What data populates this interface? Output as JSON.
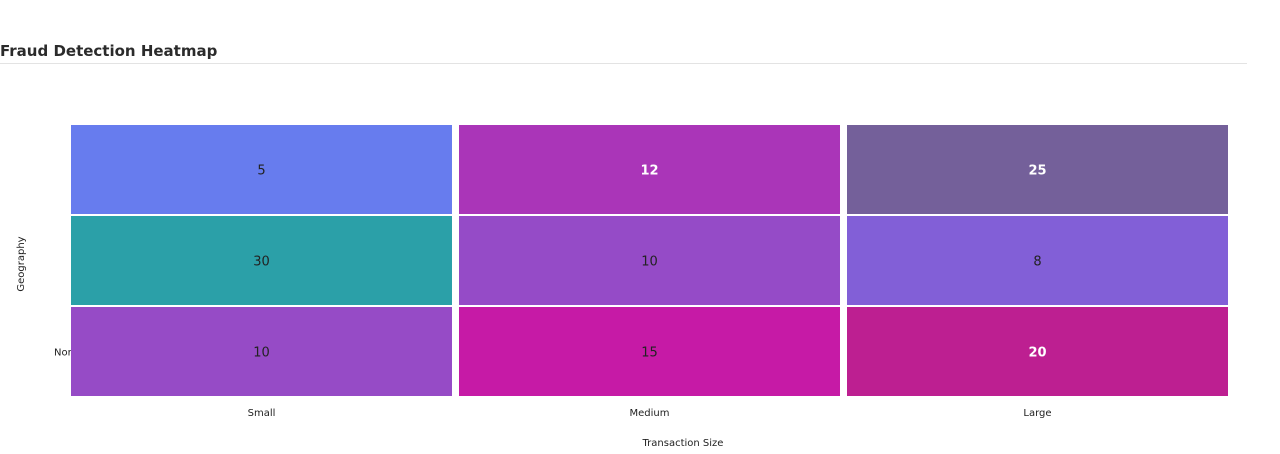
{
  "chart_data": {
    "type": "heatmap",
    "title": "Fraud Detection Heatmap",
    "xlabel": "Transaction Size",
    "ylabel": "Geography",
    "x_categories": [
      "Small",
      "Medium",
      "Large"
    ],
    "y_categories": [
      "",
      "",
      "Nor"
    ],
    "values": [
      [
        5,
        12,
        25
      ],
      [
        30,
        10,
        8
      ],
      [
        10,
        15,
        20
      ]
    ],
    "cell_colors": [
      [
        "#677cee",
        "#aa35b8",
        "#74609a"
      ],
      [
        "#2ba0a8",
        "#954bc7",
        "#825fd7"
      ],
      [
        "#964bc6",
        "#c61aa6",
        "#bd1f91"
      ]
    ],
    "label_colors": [
      [
        "#222222",
        "#ffffff",
        "#ffffff"
      ],
      [
        "#222222",
        "#222222",
        "#222222"
      ],
      [
        "#222222",
        "#222222",
        "#ffffff"
      ]
    ],
    "label_weights": [
      [
        "normal",
        "bold",
        "bold"
      ],
      [
        "normal",
        "normal",
        "normal"
      ],
      [
        "normal",
        "normal",
        "bold"
      ]
    ],
    "grid": false,
    "legend": "none"
  }
}
